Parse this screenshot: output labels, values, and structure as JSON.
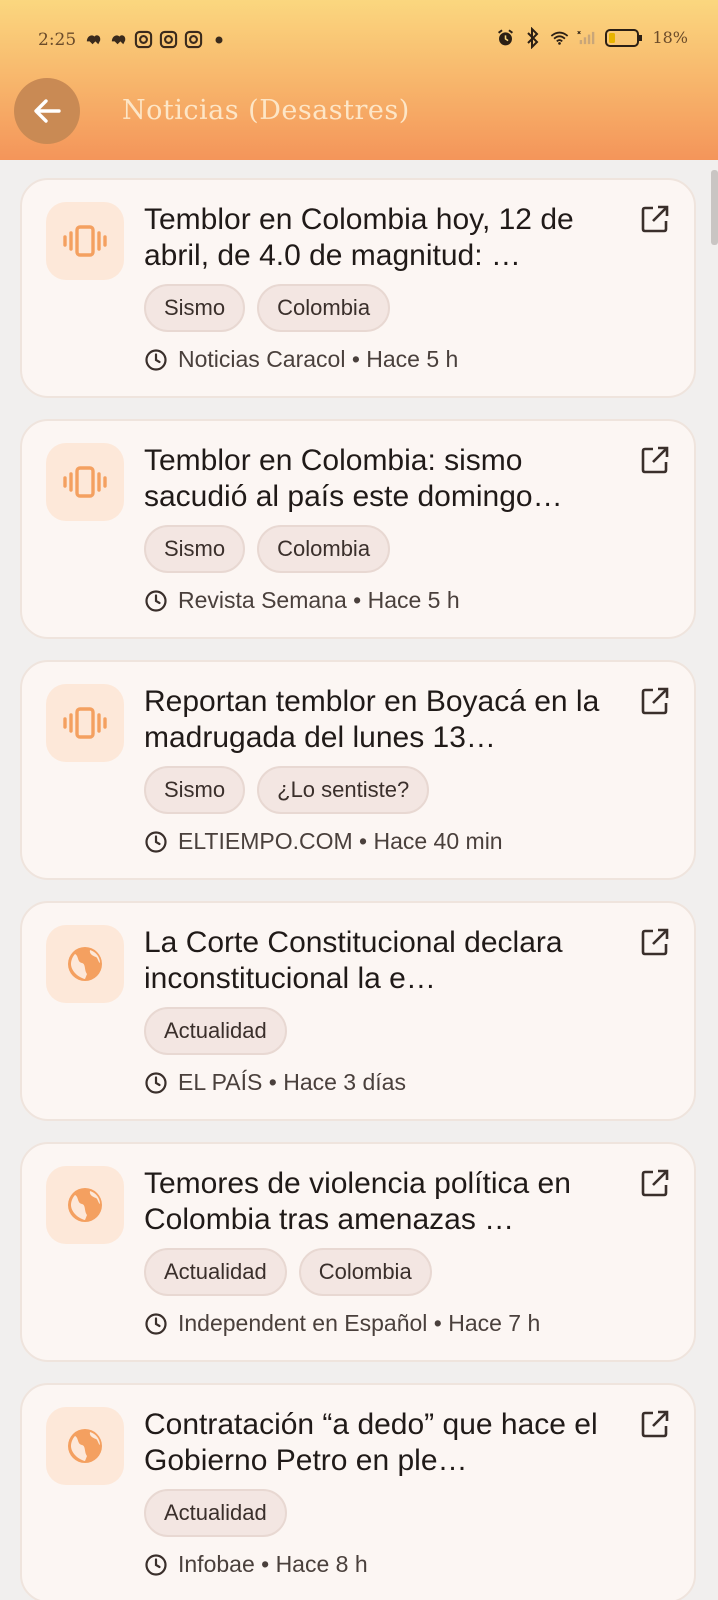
{
  "status_bar": {
    "time": "2:25",
    "battery": "18%",
    "notification_icons": [
      "app-icon",
      "app-icon",
      "instagram-icon",
      "instagram-icon",
      "instagram-icon",
      "dot-icon"
    ],
    "system_icons": [
      "alarm-icon",
      "bluetooth-icon",
      "wifi-icon",
      "signal-icon",
      "battery-icon"
    ]
  },
  "header": {
    "title": "Noticias (Desastres)",
    "back_icon": "arrow-left-icon"
  },
  "colors": {
    "accent": "#f4a060",
    "header_top": "#fbd77f",
    "header_bottom": "#f4955a",
    "card_bg": "#fcf6f3",
    "icon_bg": "#fde8d9"
  },
  "articles": [
    {
      "icon": "vibration-icon",
      "title": "Temblor en Colombia hoy, 12 de abril, de 4.0 de magnitud: …",
      "tags": [
        "Sismo",
        "Colombia"
      ],
      "meta": "Noticias Caracol • Hace 5 h"
    },
    {
      "icon": "vibration-icon",
      "title": "Temblor en Colombia: sismo sacudió al país este domingo…",
      "tags": [
        "Sismo",
        "Colombia"
      ],
      "meta": "Revista Semana • Hace 5 h"
    },
    {
      "icon": "vibration-icon",
      "title": "Reportan temblor en Boyacá en la madrugada del lunes 13…",
      "tags": [
        "Sismo",
        "¿Lo sentiste?"
      ],
      "meta": "ELTIEMPO.COM • Hace 40 min"
    },
    {
      "icon": "globe-icon",
      "title": "La Corte Constitucional declara inconstitucional la e…",
      "tags": [
        "Actualidad"
      ],
      "meta": "EL PAÍS • Hace 3 días"
    },
    {
      "icon": "globe-icon",
      "title": "Temores de violencia política en Colombia tras amenazas …",
      "tags": [
        "Actualidad",
        "Colombia"
      ],
      "meta": "Independent en Español • Hace 7 h"
    },
    {
      "icon": "globe-icon",
      "title": "Contratación “a dedo” que hace el Gobierno Petro en ple…",
      "tags": [
        "Actualidad"
      ],
      "meta": "Infobae • Hace 8 h"
    }
  ]
}
